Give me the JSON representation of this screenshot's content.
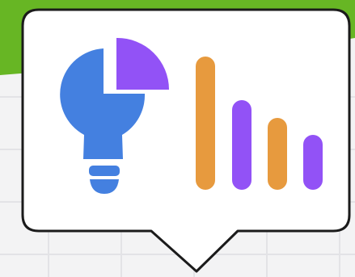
{
  "colors": {
    "banner_green": "#67B624",
    "grid_background": "#F3F3F4",
    "grid_line": "#E3E3E6",
    "bubble_fill": "#FFFFFF",
    "bubble_outline": "#1B1B1B",
    "pie_blue": "#4480E0",
    "pie_purple": "#9252F6",
    "bar_orange": "#E79A3E",
    "bar_purple": "#9252F6"
  },
  "icons": {
    "illustration": "analytics-insight-speech-bubble",
    "bulb": "lightbulb-pie-chart-icon",
    "bars": "bar-chart-icon"
  }
}
